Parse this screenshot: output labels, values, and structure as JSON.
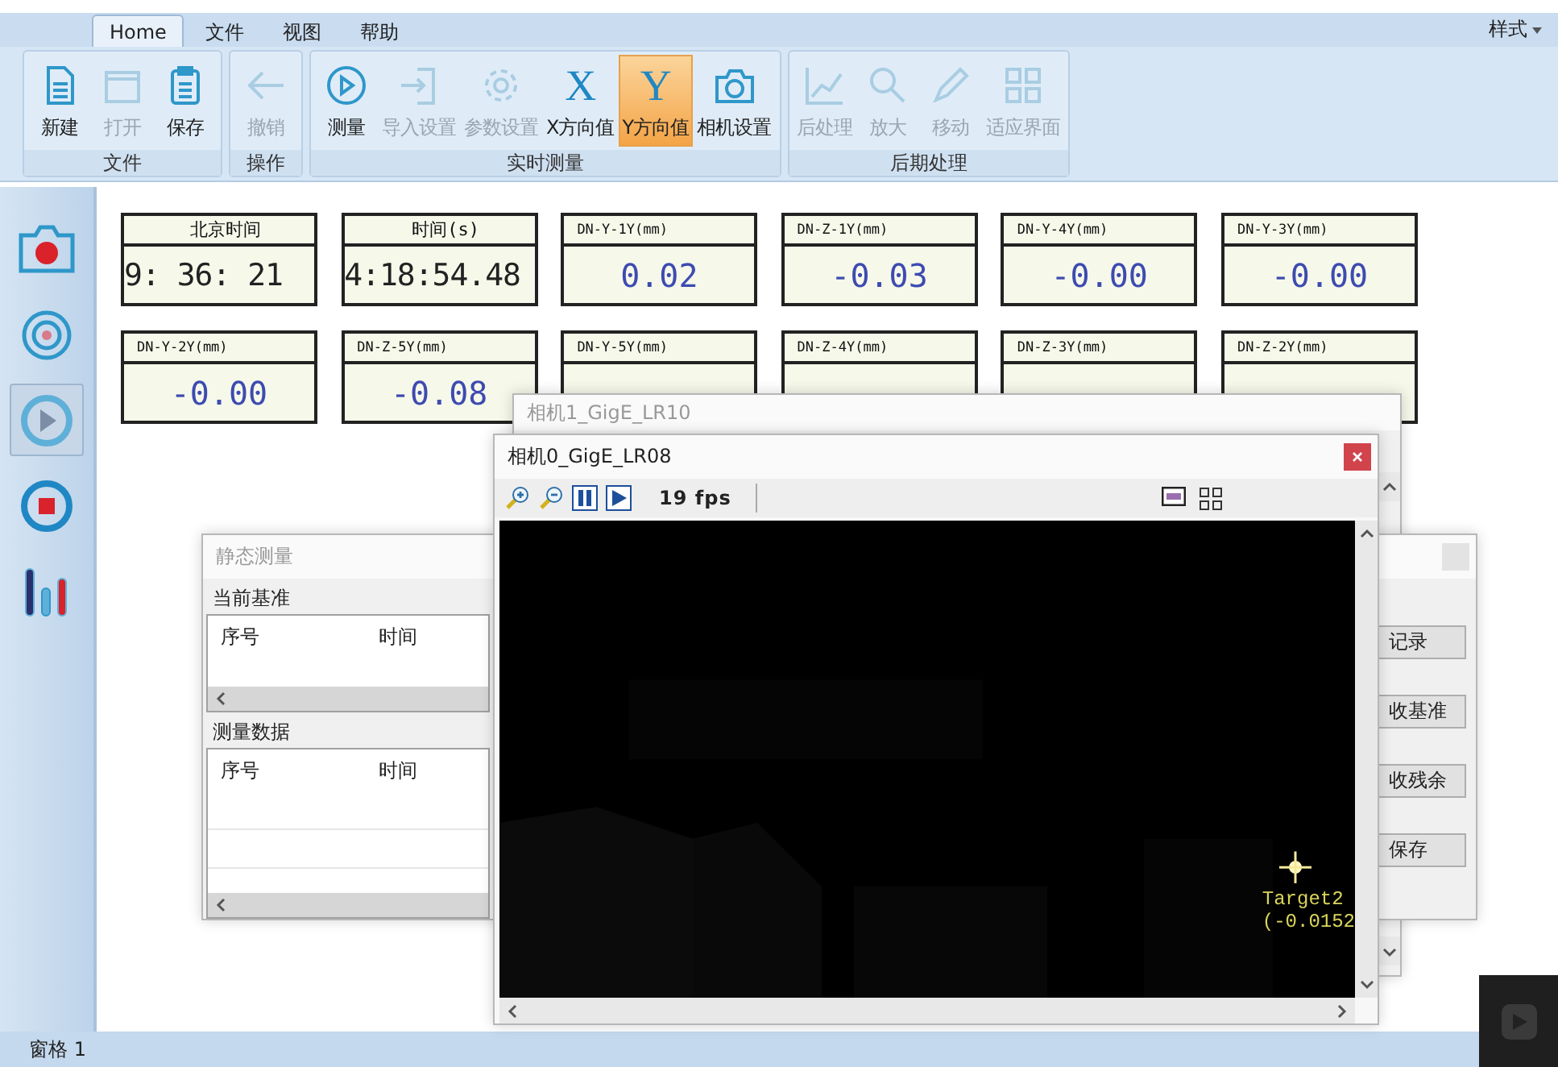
{
  "menu_tabs": [
    {
      "label": "Home",
      "selected": true
    },
    {
      "label": "文件",
      "selected": false
    },
    {
      "label": "视图",
      "selected": false
    },
    {
      "label": "帮助",
      "selected": false
    }
  ],
  "style_menu": {
    "label": "样式"
  },
  "ribbon": {
    "groups": [
      {
        "title": "文件",
        "buttons": [
          {
            "label": "新建",
            "kind": "document",
            "disabled": false,
            "selected": false
          },
          {
            "label": "打开",
            "kind": "folder",
            "disabled": true,
            "selected": false
          },
          {
            "label": "保存",
            "kind": "clipboard",
            "disabled": false,
            "selected": false
          }
        ]
      },
      {
        "title": "操作",
        "buttons": [
          {
            "label": "撤销",
            "kind": "arrow",
            "disabled": true,
            "selected": false
          }
        ]
      },
      {
        "title": "实时测量",
        "buttons": [
          {
            "label": "测量",
            "kind": "play",
            "disabled": false,
            "selected": false
          },
          {
            "label": "导入设置",
            "kind": "import",
            "disabled": true,
            "selected": false
          },
          {
            "label": "参数设置",
            "kind": "gear",
            "disabled": true,
            "selected": false
          },
          {
            "label": "X方向值",
            "kind": "letter",
            "glyph": "X",
            "disabled": false,
            "selected": false
          },
          {
            "label": "Y方向值",
            "kind": "letter",
            "glyph": "Y",
            "disabled": false,
            "selected": true
          },
          {
            "label": "相机设置",
            "kind": "camera",
            "disabled": false,
            "selected": false
          }
        ]
      },
      {
        "title": "后期处理",
        "buttons": [
          {
            "label": "后处理",
            "kind": "chart",
            "disabled": true,
            "selected": false
          },
          {
            "label": "放大",
            "kind": "magnifier",
            "disabled": true,
            "selected": false
          },
          {
            "label": "移动",
            "kind": "pencil",
            "disabled": true,
            "selected": false
          },
          {
            "label": "适应界面",
            "kind": "grid",
            "disabled": true,
            "selected": false
          }
        ]
      }
    ]
  },
  "sidebar": {
    "items": [
      {
        "kind": "camera",
        "selected": false
      },
      {
        "kind": "target",
        "selected": false
      },
      {
        "kind": "play",
        "selected": true
      },
      {
        "kind": "stop",
        "selected": false
      },
      {
        "kind": "bars",
        "selected": false
      }
    ]
  },
  "readouts": [
    {
      "label": "北京时间",
      "value": "9: 36: 21",
      "kind": "time"
    },
    {
      "label": "时间(s)",
      "value": "4:18:54.48",
      "kind": "time"
    },
    {
      "label": "DN-Y-1Y(mm)",
      "value": "0.02",
      "kind": "measure"
    },
    {
      "label": "DN-Z-1Y(mm)",
      "value": "-0.03",
      "kind": "measure"
    },
    {
      "label": "DN-Y-4Y(mm)",
      "value": "-0.00",
      "kind": "measure"
    },
    {
      "label": "DN-Y-3Y(mm)",
      "value": "-0.00",
      "kind": "measure"
    },
    {
      "label": "DN-Y-2Y(mm)",
      "value": "-0.00",
      "kind": "measure"
    },
    {
      "label": "DN-Z-5Y(mm)",
      "value": "-0.08",
      "kind": "measure"
    },
    {
      "label": "DN-Y-5Y(mm)",
      "kind": "measure"
    },
    {
      "label": "DN-Z-4Y(mm)",
      "kind": "measure"
    },
    {
      "label": "DN-Z-3Y(mm)",
      "kind": "measure"
    },
    {
      "label": "DN-Z-2Y(mm)",
      "kind": "measure"
    }
  ],
  "camera_back": {
    "title": "相机1_GigE_LR10"
  },
  "static_window": {
    "title": "静态测量",
    "sections": [
      {
        "title": "当前基准",
        "columns": [
          "序号",
          "时间"
        ]
      },
      {
        "title": "测量数据",
        "columns": [
          "序号",
          "时间"
        ]
      }
    ],
    "buttons": [
      "记录",
      "收基准",
      "收残余",
      "保存"
    ]
  },
  "camera_front": {
    "title": "相机0_GigE_LR08",
    "tools": [
      {
        "kind": "zoom-in"
      },
      {
        "kind": "zoom-out"
      },
      {
        "kind": "pause"
      },
      {
        "kind": "play"
      }
    ],
    "fps": "19 fps",
    "target": {
      "name": "Target2",
      "coords": "(-0.0152"
    }
  },
  "status_bar": {
    "pane": "窗格 1"
  }
}
